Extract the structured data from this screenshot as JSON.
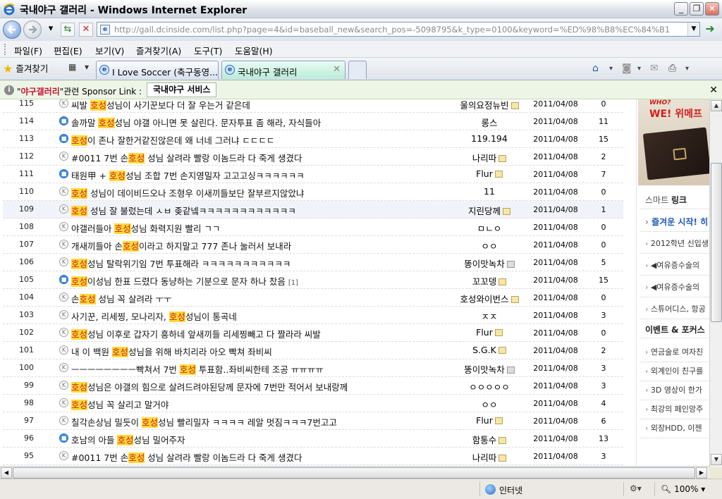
{
  "window": {
    "title": "국내야구 갤러리 - Windows Internet Explorer"
  },
  "address_bar": {
    "url": "http://gall.dcinside.com/list.php?page=4&id=baseball_new&search_pos=-5098795&k_type=0100&keyword=%ED%98%B8%EC%84%B1"
  },
  "menu": [
    "파일(F)",
    "편집(E)",
    "보기(V)",
    "즐겨찾기(A)",
    "도구(T)",
    "도움말(H)"
  ],
  "tabs": {
    "favorites_label": "즐겨찾기",
    "items": [
      {
        "label": "I Love Soccer (축구동영..."
      },
      {
        "label": "국내야구 갤러리"
      }
    ]
  },
  "sponsor": {
    "quote_prefix": "\"",
    "gallery": "야구갤러리",
    "suffix": "\"관련 Sponsor Link :",
    "button": "국내야구 서비스"
  },
  "rows": [
    {
      "num": "115",
      "icon": "grey",
      "pre": "씨발 ",
      "kw": "호성",
      "post": "성님이 사기꾼보다 더 잘 우는거 같은데",
      "cmt": "",
      "author": "울의요정뉴빈",
      "badge": "gold",
      "date": "2011/04/08",
      "hits": "0"
    },
    {
      "num": "114",
      "icon": "blue",
      "pre": "솔까말 ",
      "kw": "호성",
      "post": "성님 야갤 아니면 못 살린다. 문자투표 좀 해라, 자식들아",
      "cmt": "",
      "author": "롱스",
      "badge": "",
      "date": "2011/04/08",
      "hits": "11"
    },
    {
      "num": "113",
      "icon": "blue",
      "pre": "",
      "kw": "호성",
      "post": "이 존나 잘한거같진않은데 왜 너네 그러냐 ㄷㄷㄷㄷ",
      "cmt": "",
      "author": "119.194",
      "badge": "",
      "date": "2011/04/08",
      "hits": "15"
    },
    {
      "num": "112",
      "icon": "grey",
      "pre": "#0011 7번 손",
      "kw": "호성",
      "post": " 성님 살려라 빨랑 이놈드라 다 죽게 생겼다",
      "cmt": "",
      "author": "나리따",
      "badge": "gold",
      "date": "2011/04/08",
      "hits": "2"
    },
    {
      "num": "111",
      "icon": "blue",
      "pre": "태원甲 + ",
      "kw": "호성",
      "post": "성님 조합 7번 손지영밀자 고고고싱ㅋㅋㅋㅋㅋㅋ",
      "cmt": "",
      "author": "Flur",
      "badge": "gold",
      "date": "2011/04/08",
      "hits": "7"
    },
    {
      "num": "110",
      "icon": "grey",
      "pre": "",
      "kw": "호성",
      "post": " 성님이 데이비드오나 조형우 이새끼들보단 잘부르지않았냐",
      "cmt": "",
      "author": "11",
      "badge": "",
      "date": "2011/04/08",
      "hits": "0"
    },
    {
      "num": "109",
      "icon": "grey",
      "pre": "",
      "kw": "호성",
      "post": " 성님 잘 불렀는데 ㅅㅂ 좆같넼ㅋㅋㅋㅋㅋㅋㅋㅋㅋㅋㅋㅋ",
      "cmt": "",
      "author": "지린당께",
      "badge": "gold",
      "date": "2011/04/08",
      "hits": "1"
    },
    {
      "num": "108",
      "icon": "grey",
      "pre": "야갤러들아 ",
      "kw": "호성",
      "post": "성님 화력지원 빨리 ㄱㄱ",
      "cmt": "",
      "author": "ㅁㄴㅇ",
      "badge": "",
      "date": "2011/04/08",
      "hits": "0"
    },
    {
      "num": "107",
      "icon": "grey",
      "pre": "개새끼들아 손",
      "kw": "호성",
      "post": "이라고 하지말고 777 존나 눌러서 보내라",
      "cmt": "",
      "author": "ㅇㅇ",
      "badge": "",
      "date": "2011/04/08",
      "hits": "0"
    },
    {
      "num": "106",
      "icon": "grey",
      "pre": "",
      "kw": "호성",
      "post": "성님 탈락위기임 7번 투표해라 ㅋㅋㅋㅋㅋㅋㅋㅋㅋㅋㅋ",
      "cmt": "",
      "author": "똥이맛녹차",
      "badge": "grey",
      "date": "2011/04/08",
      "hits": "5"
    },
    {
      "num": "105",
      "icon": "blue",
      "pre": "",
      "kw": "호성",
      "post": "이성님 한표 드렸다 동냥하는 기분으로 문자 하나 찼음 ",
      "cmt": "[1]",
      "author": "꼬꼬뎅",
      "badge": "gold",
      "date": "2011/04/08",
      "hits": "15"
    },
    {
      "num": "104",
      "icon": "grey",
      "pre": "손",
      "kw": "호성",
      "post": " 성님 꼭 살려라 ㅜㅜ",
      "cmt": "",
      "author": "호성와이번스",
      "badge": "gold",
      "date": "2011/04/08",
      "hits": "0"
    },
    {
      "num": "103",
      "icon": "grey",
      "pre": "사기꾼, 리세찡, 모나리자, ",
      "kw": "호성",
      "post": "성님이 통곡네",
      "cmt": "",
      "author": "ㅈㅈ",
      "badge": "",
      "date": "2011/04/08",
      "hits": "3"
    },
    {
      "num": "102",
      "icon": "grey",
      "pre": "",
      "kw": "호성",
      "post": "성님 이후로 갑자기 흥하네 앞새끼들 리세찡빼고 다 짤라라 씨발",
      "cmt": "",
      "author": "Flur",
      "badge": "gold",
      "date": "2011/04/08",
      "hits": "0"
    },
    {
      "num": "101",
      "icon": "grey",
      "pre": "내 이 백원 ",
      "kw": "호성",
      "post": "성님을 위해 바치리라 아오 빡쳐 좌비씨",
      "cmt": "",
      "author": "S.G.K",
      "badge": "gold",
      "date": "2011/04/08",
      "hits": "2"
    },
    {
      "num": "100",
      "icon": "grey",
      "pre": "ㅡㅡㅡㅡㅡㅡㅡㅡ빡쳐서 7번 ",
      "kw": "호성",
      "post": " 투표함..좌비씨한테 조공 ㅠㅠㅠㅠ",
      "cmt": "",
      "author": "똥이맛녹차",
      "badge": "grey",
      "date": "2011/04/08",
      "hits": "3"
    },
    {
      "num": "99",
      "icon": "grey",
      "pre": "",
      "kw": "호성",
      "post": "성님은 야갤의 힘으로 살려드려야된당께 문자에 7번만 적어서 보내랑께",
      "cmt": "",
      "author": "ㅇㅇㅇㅇㅇ",
      "badge": "",
      "date": "2011/04/08",
      "hits": "3"
    },
    {
      "num": "98",
      "icon": "grey",
      "pre": "",
      "kw": "호성",
      "post": "성님 꼭 살리고 말거야",
      "cmt": "",
      "author": "ㅇㅇ",
      "badge": "",
      "date": "2011/04/08",
      "hits": "4"
    },
    {
      "num": "97",
      "icon": "grey",
      "pre": "칠각손상님 밀듯이 ",
      "kw": "호성",
      "post": "성님 빨리밀자 ㅋㅋㅋㅋ 레알 멋짐ㅋㅋㅋ7번고고",
      "cmt": "",
      "author": "Flur",
      "badge": "gold",
      "date": "2011/04/08",
      "hits": "6"
    },
    {
      "num": "96",
      "icon": "blue",
      "pre": "호남의 아들 ",
      "kw": "호성",
      "post": "성님 밀어주자",
      "cmt": "",
      "author": "함통수",
      "badge": "gold",
      "date": "2011/04/08",
      "hits": "13"
    },
    {
      "num": "95",
      "icon": "grey",
      "pre": "#0011 7번 손",
      "kw": "호성",
      "post": " 성님 살려라 빨랑 이놈드라 다 죽게 생겼다",
      "cmt": "",
      "author": "나리따",
      "badge": "gold",
      "date": "2011/04/08",
      "hits": "3"
    }
  ],
  "sidebar": {
    "ad_logo_small": "WHO?",
    "ad_logo": "WE! 위메프",
    "smart_link_head_1": "스마트",
    "smart_link_head_2": "링크",
    "links_1": [
      "즐겨운 시작! 히",
      "2012학년 신입생",
      "◀여유증수술의",
      "◀여유증수술의",
      "스튜어디스, 항공"
    ],
    "event_head_1": "이벤트",
    "event_head_2": "& 포커스",
    "links_2": [
      "연금술로 여자친",
      "외계인이 친구를",
      "3D 영상이 한가",
      "최강의 페인앙주",
      "외장HDD, 이젠"
    ]
  },
  "status": {
    "zone": "인터넷",
    "zoom": "100%"
  }
}
